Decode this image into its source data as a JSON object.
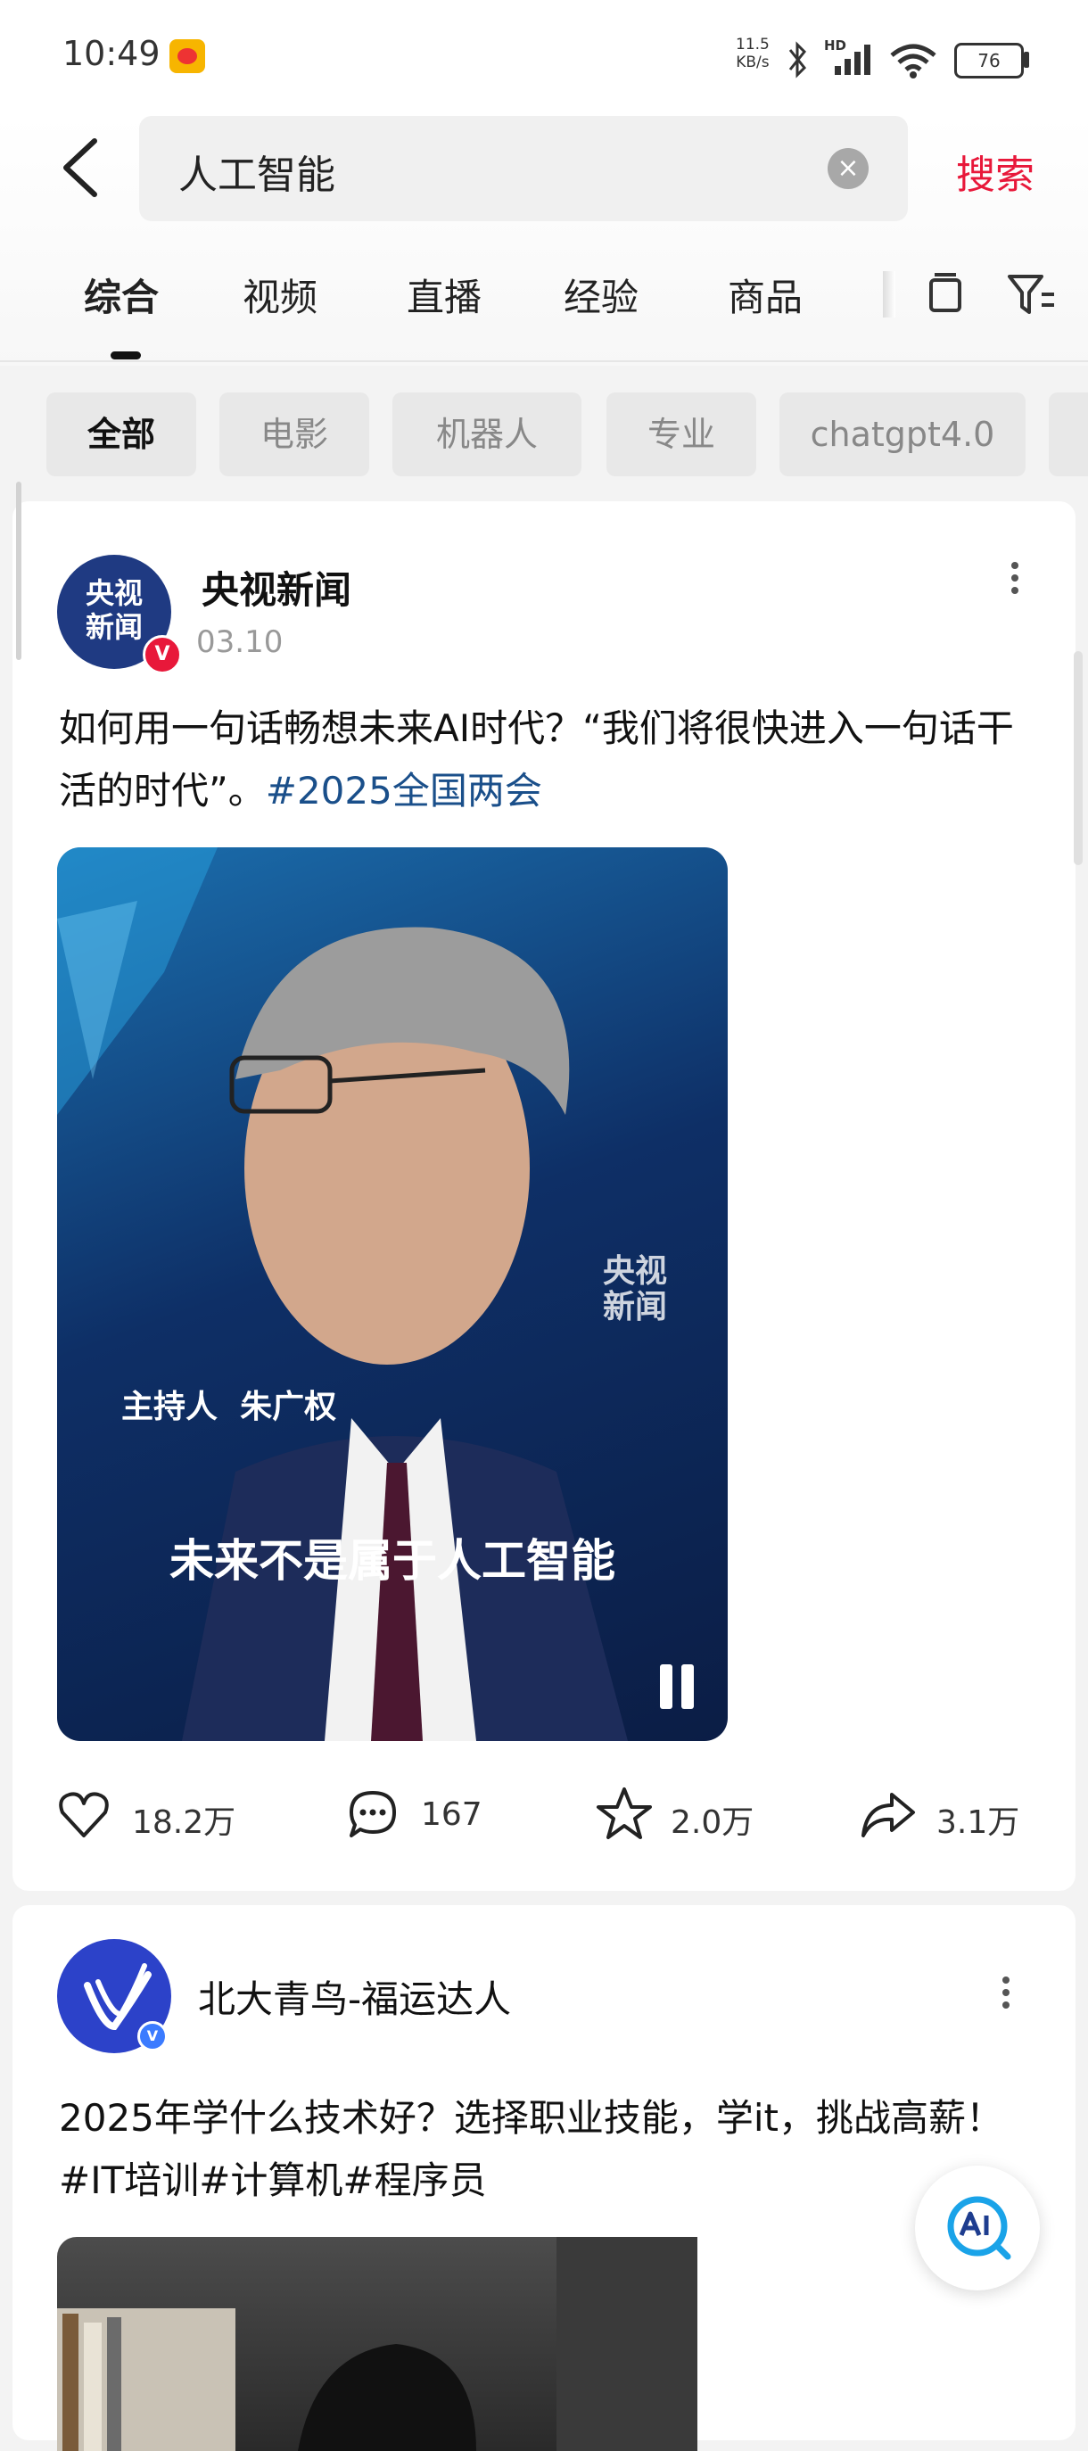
{
  "status_bar": {
    "time": "10:49",
    "net_speed_value": "11.5",
    "net_speed_unit": "KB/s",
    "network": "HD",
    "battery": "76"
  },
  "search": {
    "query": "人工智能",
    "submit_label": "搜索"
  },
  "tabs": [
    "综合",
    "视频",
    "直播",
    "经验",
    "商品"
  ],
  "active_tab": "综合",
  "chips": [
    "全部",
    "电影",
    "机器人",
    "专业",
    "chatgpt4.0"
  ],
  "posts": [
    {
      "author": "央视新闻",
      "avatar_text": "央视新闻",
      "date": "03.10",
      "text": "如何用一句话畅想未来AI时代？“我们将很快进入一句话干活的时代”。",
      "hashtag": "#2025全国两会",
      "video": {
        "watermark": "央视新闻",
        "caption_name": "主持人  朱广权",
        "subtitle": "未来不是属于人工智能"
      },
      "likes": "18.2万",
      "comments": "167",
      "favorites": "2.0万",
      "shares": "3.1万"
    },
    {
      "author": "北大青鸟-福运达人",
      "text": "2025年学什么技术好？选择职业技能，学it，挑战高薪！#IT培训#计算机#程序员"
    }
  ],
  "colors": {
    "accent": "#e8183a",
    "hashtag": "#1a4f8a",
    "verified_red": "#e8183a",
    "verified_blue": "#3b7bff"
  }
}
